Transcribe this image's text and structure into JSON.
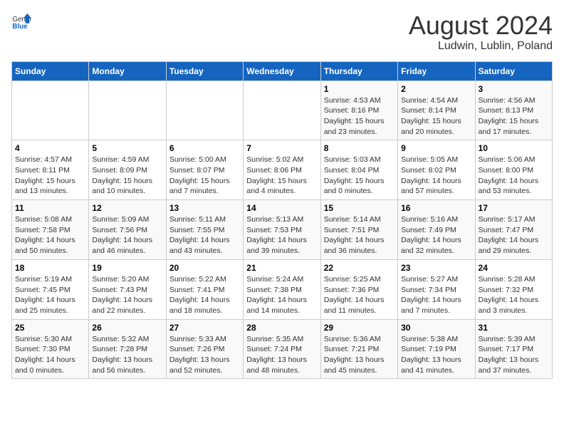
{
  "header": {
    "logo_general": "General",
    "logo_blue": "Blue",
    "title": "August 2024",
    "subtitle": "Ludwin, Lublin, Poland"
  },
  "days_of_week": [
    "Sunday",
    "Monday",
    "Tuesday",
    "Wednesday",
    "Thursday",
    "Friday",
    "Saturday"
  ],
  "weeks": [
    [
      {
        "day": "",
        "info": ""
      },
      {
        "day": "",
        "info": ""
      },
      {
        "day": "",
        "info": ""
      },
      {
        "day": "",
        "info": ""
      },
      {
        "day": "1",
        "info": "Sunrise: 4:53 AM\nSunset: 8:16 PM\nDaylight: 15 hours\nand 23 minutes."
      },
      {
        "day": "2",
        "info": "Sunrise: 4:54 AM\nSunset: 8:14 PM\nDaylight: 15 hours\nand 20 minutes."
      },
      {
        "day": "3",
        "info": "Sunrise: 4:56 AM\nSunset: 8:13 PM\nDaylight: 15 hours\nand 17 minutes."
      }
    ],
    [
      {
        "day": "4",
        "info": "Sunrise: 4:57 AM\nSunset: 8:11 PM\nDaylight: 15 hours\nand 13 minutes."
      },
      {
        "day": "5",
        "info": "Sunrise: 4:59 AM\nSunset: 8:09 PM\nDaylight: 15 hours\nand 10 minutes."
      },
      {
        "day": "6",
        "info": "Sunrise: 5:00 AM\nSunset: 8:07 PM\nDaylight: 15 hours\nand 7 minutes."
      },
      {
        "day": "7",
        "info": "Sunrise: 5:02 AM\nSunset: 8:06 PM\nDaylight: 15 hours\nand 4 minutes."
      },
      {
        "day": "8",
        "info": "Sunrise: 5:03 AM\nSunset: 8:04 PM\nDaylight: 15 hours\nand 0 minutes."
      },
      {
        "day": "9",
        "info": "Sunrise: 5:05 AM\nSunset: 8:02 PM\nDaylight: 14 hours\nand 57 minutes."
      },
      {
        "day": "10",
        "info": "Sunrise: 5:06 AM\nSunset: 8:00 PM\nDaylight: 14 hours\nand 53 minutes."
      }
    ],
    [
      {
        "day": "11",
        "info": "Sunrise: 5:08 AM\nSunset: 7:58 PM\nDaylight: 14 hours\nand 50 minutes."
      },
      {
        "day": "12",
        "info": "Sunrise: 5:09 AM\nSunset: 7:56 PM\nDaylight: 14 hours\nand 46 minutes."
      },
      {
        "day": "13",
        "info": "Sunrise: 5:11 AM\nSunset: 7:55 PM\nDaylight: 14 hours\nand 43 minutes."
      },
      {
        "day": "14",
        "info": "Sunrise: 5:13 AM\nSunset: 7:53 PM\nDaylight: 14 hours\nand 39 minutes."
      },
      {
        "day": "15",
        "info": "Sunrise: 5:14 AM\nSunset: 7:51 PM\nDaylight: 14 hours\nand 36 minutes."
      },
      {
        "day": "16",
        "info": "Sunrise: 5:16 AM\nSunset: 7:49 PM\nDaylight: 14 hours\nand 32 minutes."
      },
      {
        "day": "17",
        "info": "Sunrise: 5:17 AM\nSunset: 7:47 PM\nDaylight: 14 hours\nand 29 minutes."
      }
    ],
    [
      {
        "day": "18",
        "info": "Sunrise: 5:19 AM\nSunset: 7:45 PM\nDaylight: 14 hours\nand 25 minutes."
      },
      {
        "day": "19",
        "info": "Sunrise: 5:20 AM\nSunset: 7:43 PM\nDaylight: 14 hours\nand 22 minutes."
      },
      {
        "day": "20",
        "info": "Sunrise: 5:22 AM\nSunset: 7:41 PM\nDaylight: 14 hours\nand 18 minutes."
      },
      {
        "day": "21",
        "info": "Sunrise: 5:24 AM\nSunset: 7:38 PM\nDaylight: 14 hours\nand 14 minutes."
      },
      {
        "day": "22",
        "info": "Sunrise: 5:25 AM\nSunset: 7:36 PM\nDaylight: 14 hours\nand 11 minutes."
      },
      {
        "day": "23",
        "info": "Sunrise: 5:27 AM\nSunset: 7:34 PM\nDaylight: 14 hours\nand 7 minutes."
      },
      {
        "day": "24",
        "info": "Sunrise: 5:28 AM\nSunset: 7:32 PM\nDaylight: 14 hours\nand 3 minutes."
      }
    ],
    [
      {
        "day": "25",
        "info": "Sunrise: 5:30 AM\nSunset: 7:30 PM\nDaylight: 14 hours\nand 0 minutes."
      },
      {
        "day": "26",
        "info": "Sunrise: 5:32 AM\nSunset: 7:28 PM\nDaylight: 13 hours\nand 56 minutes."
      },
      {
        "day": "27",
        "info": "Sunrise: 5:33 AM\nSunset: 7:26 PM\nDaylight: 13 hours\nand 52 minutes."
      },
      {
        "day": "28",
        "info": "Sunrise: 5:35 AM\nSunset: 7:24 PM\nDaylight: 13 hours\nand 48 minutes."
      },
      {
        "day": "29",
        "info": "Sunrise: 5:36 AM\nSunset: 7:21 PM\nDaylight: 13 hours\nand 45 minutes."
      },
      {
        "day": "30",
        "info": "Sunrise: 5:38 AM\nSunset: 7:19 PM\nDaylight: 13 hours\nand 41 minutes."
      },
      {
        "day": "31",
        "info": "Sunrise: 5:39 AM\nSunset: 7:17 PM\nDaylight: 13 hours\nand 37 minutes."
      }
    ]
  ]
}
